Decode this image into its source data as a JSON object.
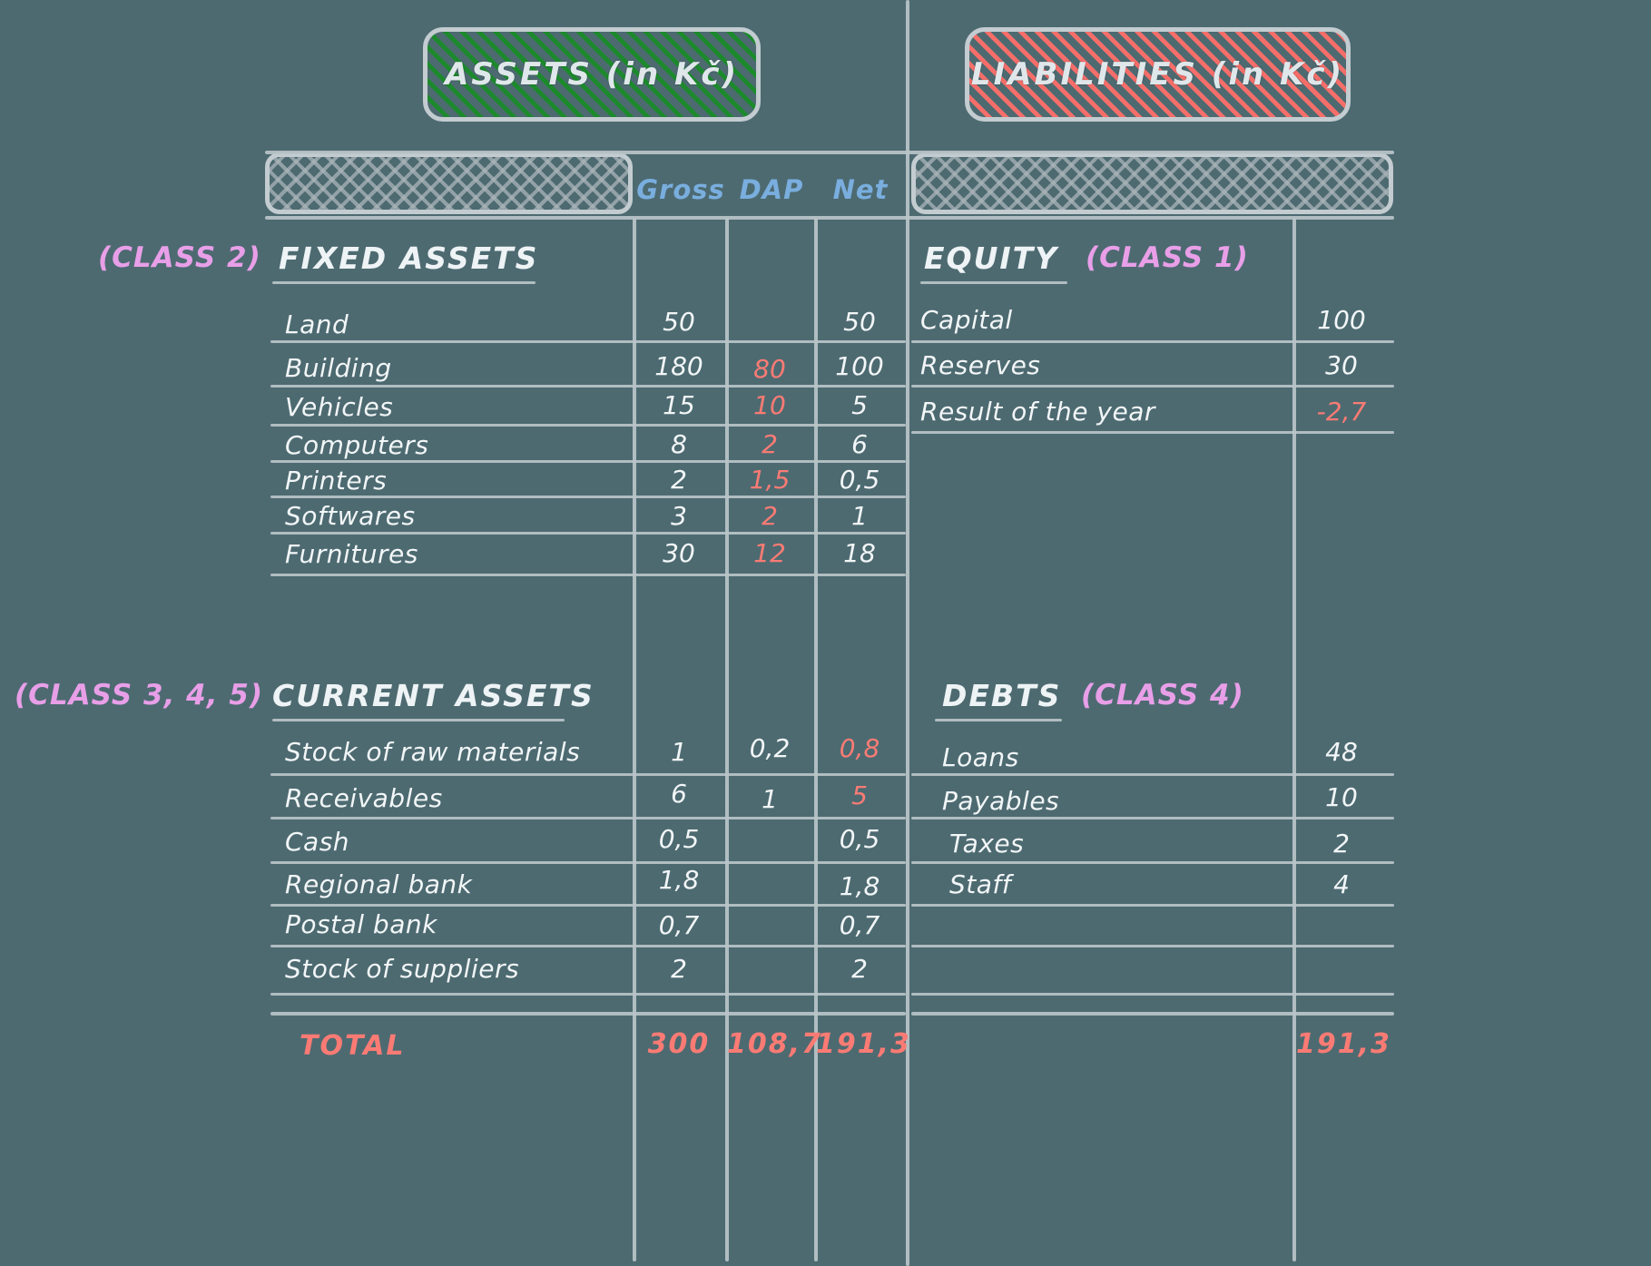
{
  "headers": {
    "assets_title": "ASSETS (in Kč)",
    "liabilities_title": "LIABILITIES (in Kč)",
    "col_gross": "Gross",
    "col_dap": "DAP",
    "col_net": "Net"
  },
  "colors": {
    "background": "#4d6a71",
    "ink": "#f2f6f7",
    "accent_red": "#fb7b74",
    "accent_blue": "#79aede",
    "accent_pink": "#e89fe8",
    "assets_hatch": "#198c28",
    "liabilities_hatch": "#ff6e69"
  },
  "assets": {
    "fixed": {
      "class_tag": "(CLASS 2)",
      "title": "FIXED ASSETS",
      "rows": [
        {
          "label": "Land",
          "gross": "50",
          "dap": "",
          "net": "50"
        },
        {
          "label": "Building",
          "gross": "180",
          "dap": "80",
          "net": "100"
        },
        {
          "label": "Vehicles",
          "gross": "15",
          "dap": "10",
          "net": "5"
        },
        {
          "label": "Computers",
          "gross": "8",
          "dap": "2",
          "net": "6"
        },
        {
          "label": "Printers",
          "gross": "2",
          "dap": "1,5",
          "net": "0,5"
        },
        {
          "label": "Softwares",
          "gross": "3",
          "dap": "2",
          "net": "1"
        },
        {
          "label": "Furnitures",
          "gross": "30",
          "dap": "12",
          "net": "18"
        }
      ]
    },
    "current": {
      "class_tag": "(CLASS 3, 4, 5)",
      "title": "CURRENT ASSETS",
      "rows": [
        {
          "label": "Stock of raw materials",
          "gross": "1",
          "dap": "0,2",
          "net": "0,8",
          "net_red": true
        },
        {
          "label": "Receivables",
          "gross": "6",
          "dap": "1",
          "net": "5",
          "net_red": true
        },
        {
          "label": "Cash",
          "gross": "0,5",
          "dap": "",
          "net": "0,5"
        },
        {
          "label": "Regional bank",
          "gross": "1,8",
          "dap": "",
          "net": "1,8"
        },
        {
          "label": "Postal bank",
          "gross": "0,7",
          "dap": "",
          "net": "0,7"
        },
        {
          "label": "Stock of suppliers",
          "gross": "2",
          "dap": "",
          "net": "2"
        }
      ]
    },
    "total": {
      "label": "TOTAL",
      "gross": "300",
      "dap": "108,7",
      "net": "191,3"
    }
  },
  "liabilities": {
    "equity": {
      "title": "EQUITY",
      "class_tag": "(CLASS 1)",
      "rows": [
        {
          "label": "Capital",
          "value": "100"
        },
        {
          "label": "Reserves",
          "value": "30"
        },
        {
          "label": "Result of the year",
          "value": "-2,7",
          "red": true
        }
      ]
    },
    "debts": {
      "title": "DEBTS",
      "class_tag": "(CLASS 4)",
      "rows": [
        {
          "label": "Loans",
          "value": "48"
        },
        {
          "label": "Payables",
          "value": "10"
        },
        {
          "label": "Taxes",
          "value": "2"
        },
        {
          "label": "Staff",
          "value": "4"
        }
      ]
    },
    "total": {
      "value": "191,3"
    }
  }
}
